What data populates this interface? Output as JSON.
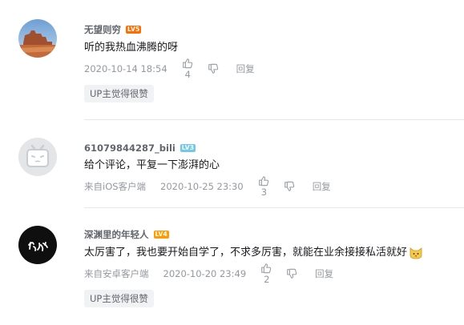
{
  "comments": [
    {
      "username": "无望则穷",
      "level": "LV5",
      "level_color": "#ff6c00",
      "text": "听的我热血沸腾的呀",
      "device": "",
      "time": "2020-10-14 18:54",
      "likes": "4",
      "reply_label": "回复",
      "up_tag": "UP主觉得很赞",
      "avatar_icon": "desert-butte-photo"
    },
    {
      "username": "61079844287_bili",
      "level": "LV3",
      "level_color": "#73c9e5",
      "text": "给个评论，平复一下澎湃的心",
      "device": "来自iOS客户端",
      "time": "2020-10-25 23:30",
      "likes": "3",
      "reply_label": "回复",
      "avatar_icon": "bilibili-tv-default-avatar"
    },
    {
      "username": "深渊里的年轻人",
      "level": "LV4",
      "level_color": "#ff9a00",
      "text": "太厉害了，我也要开始自学了，不求多厉害，就能在业余接接私活就好",
      "emoji": "cat-face-emoji",
      "device": "来自安卓客户端",
      "time": "2020-10-20 23:49",
      "likes": "2",
      "reply_label": "回复",
      "up_tag": "UP主觉得很赞",
      "avatar_icon": "calligraphy-logo"
    }
  ]
}
